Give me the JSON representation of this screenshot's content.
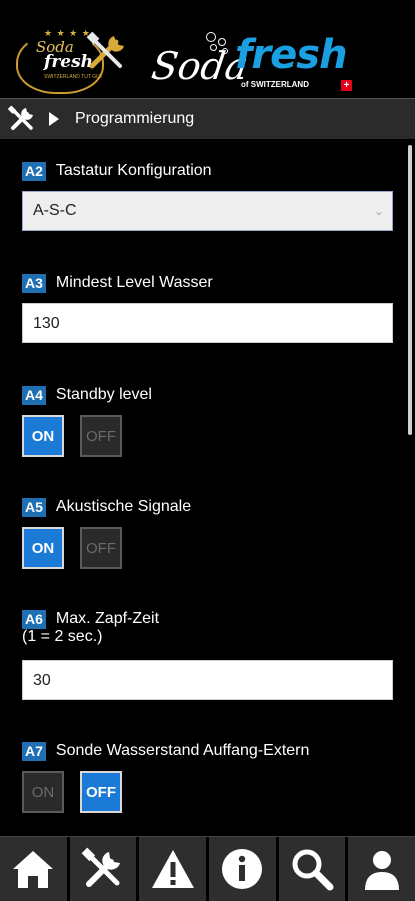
{
  "header": {
    "logo_left": {
      "line1": "Soda",
      "line2": "fresh",
      "line3": "SWITZERLAND TUT GUT"
    },
    "logo_mid": {
      "text": "Soda"
    },
    "logo_right": {
      "text": "fresh",
      "sub": "of SWITZERLAND",
      "flag": "+"
    }
  },
  "breadcrumb": {
    "title": "Programmierung"
  },
  "fields": [
    {
      "code": "A2",
      "label": "Tastatur Konfiguration",
      "type": "select",
      "value": "A-S-C"
    },
    {
      "code": "A3",
      "label": "Mindest Level Wasser",
      "type": "input",
      "value": "130"
    },
    {
      "code": "A4",
      "label": "Standby level",
      "type": "toggle",
      "on_label": "ON",
      "off_label": "OFF",
      "state": "on"
    },
    {
      "code": "A5",
      "label": "Akustische Signale",
      "type": "toggle",
      "on_label": "ON",
      "off_label": "OFF",
      "state": "on"
    },
    {
      "code": "A6",
      "label": "Max. Zapf-Zeit",
      "label2": "(1 = 2 sec.)",
      "type": "input",
      "value": "30"
    },
    {
      "code": "A7",
      "label": "Sonde Wasserstand Auffang-Extern",
      "type": "toggle",
      "on_label": "ON",
      "off_label": "OFF",
      "state": "off"
    }
  ],
  "bottom_nav": [
    "home-icon",
    "tools-icon",
    "warning-icon",
    "info-icon",
    "search-icon",
    "user-icon"
  ],
  "colors": {
    "accent": "#1b7ad6",
    "badge": "#1e6fb3",
    "brand_blue": "#1aa0e2",
    "gold": "#c89b2c"
  }
}
